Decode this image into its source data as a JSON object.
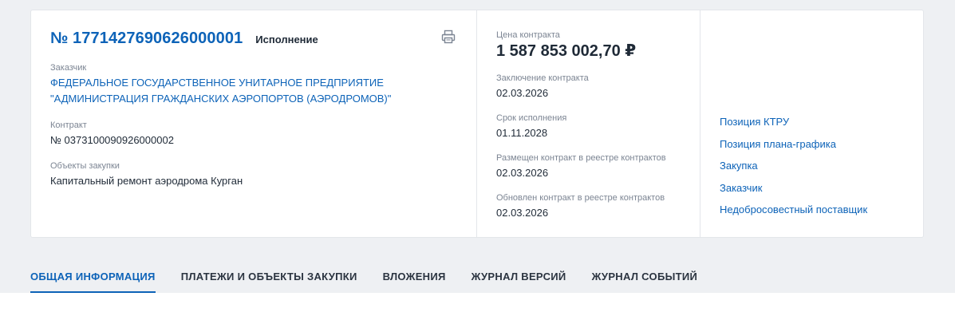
{
  "contract": {
    "number": "№ 1771427690626000001",
    "status": "Исполнение",
    "customer_label": "Заказчик",
    "customer_name": "ФЕДЕРАЛЬНОЕ ГОСУДАРСТВЕННОЕ УНИТАРНОЕ ПРЕДПРИЯТИЕ \"АДМИНИСТРАЦИЯ ГРАЖДАНСКИХ АЭРОПОРТОВ (АЭРОДРОМОВ)\"",
    "contract_label": "Контракт",
    "contract_ref": "№ 0373100090926000002",
    "objects_label": "Объекты закупки",
    "objects_value": "Капитальный ремонт аэродрома Курган"
  },
  "details": {
    "price_label": "Цена контракта",
    "price_value": "1 587 853 002,70 ₽",
    "items": [
      {
        "label": "Заключение контракта",
        "value": "02.03.2026"
      },
      {
        "label": "Срок исполнения",
        "value": "01.11.2028"
      },
      {
        "label": "Размещен контракт в реестре контрактов",
        "value": "02.03.2026"
      },
      {
        "label": "Обновлен контракт в реестре контрактов",
        "value": "02.03.2026"
      }
    ]
  },
  "links": [
    "Позиция КТРУ",
    "Позиция плана-графика",
    "Закупка",
    "Заказчик",
    "Недобросовестный поставщик"
  ],
  "tabs": [
    {
      "label": "ОБЩАЯ ИНФОРМАЦИЯ",
      "active": true
    },
    {
      "label": "ПЛАТЕЖИ И ОБЪЕКТЫ ЗАКУПКИ",
      "active": false
    },
    {
      "label": "ВЛОЖЕНИЯ",
      "active": false
    },
    {
      "label": "ЖУРНАЛ ВЕРСИЙ",
      "active": false
    },
    {
      "label": "ЖУРНАЛ СОБЫТИЙ",
      "active": false
    }
  ],
  "icons": {
    "print": "print-icon"
  },
  "colors": {
    "link": "#0d63b8",
    "background": "#eef0f3",
    "card": "#ffffff"
  }
}
